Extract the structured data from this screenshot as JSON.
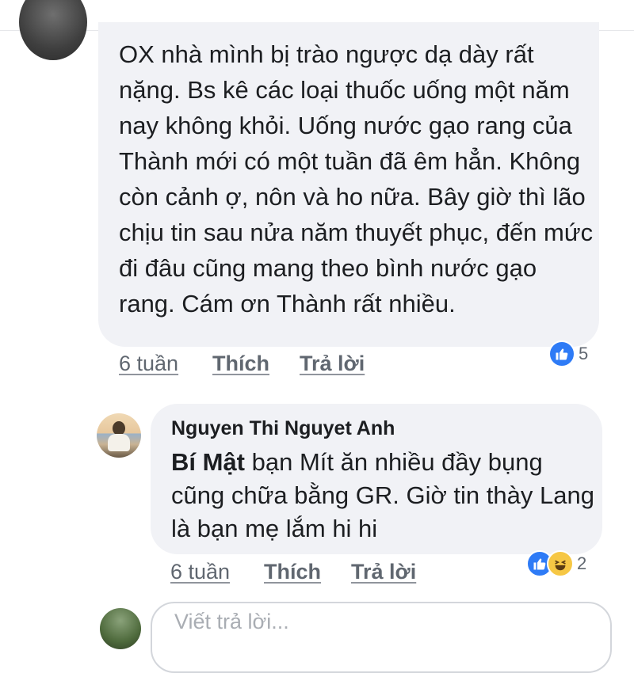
{
  "comment1": {
    "text": "OX nhà mình bị trào ngược dạ dày rất nặng. Bs kê các loại thuốc uống một năm nay không khỏi. Uống nước gạo rang của Thành mới có một tuần đã êm hẳn. Không còn cảnh ợ, nôn và ho nữa. Bây giờ thì lão chịu tin sau nửa năm thuyết phục, đến mức đi đâu cũng mang theo bình nước gạo rang. Cám ơn Thành rất nhiều.",
    "time": "6 tuần",
    "like_label": "Thích",
    "reply_label": "Trả lời",
    "reaction_count": "5"
  },
  "comment2": {
    "author": "Nguyen Thi Nguyet Anh",
    "mention": "Bí Mật",
    "text": " bạn Mít ăn nhiều đầy bụng cũng chữa bằng GR. Giờ tin thày Lang là bạn mẹ lắm hi hi",
    "time": "6 tuần",
    "like_label": "Thích",
    "reply_label": "Trả lời",
    "reaction_count": "2"
  },
  "compose": {
    "placeholder": "Viết trả lời..."
  },
  "colors": {
    "bubble": "#f1f2f6",
    "like_blue": "#2e7bf6",
    "haha_yellow": "#f6c744",
    "meta_gray": "#606770"
  },
  "icons": [
    "like-icon",
    "haha-icon"
  ]
}
